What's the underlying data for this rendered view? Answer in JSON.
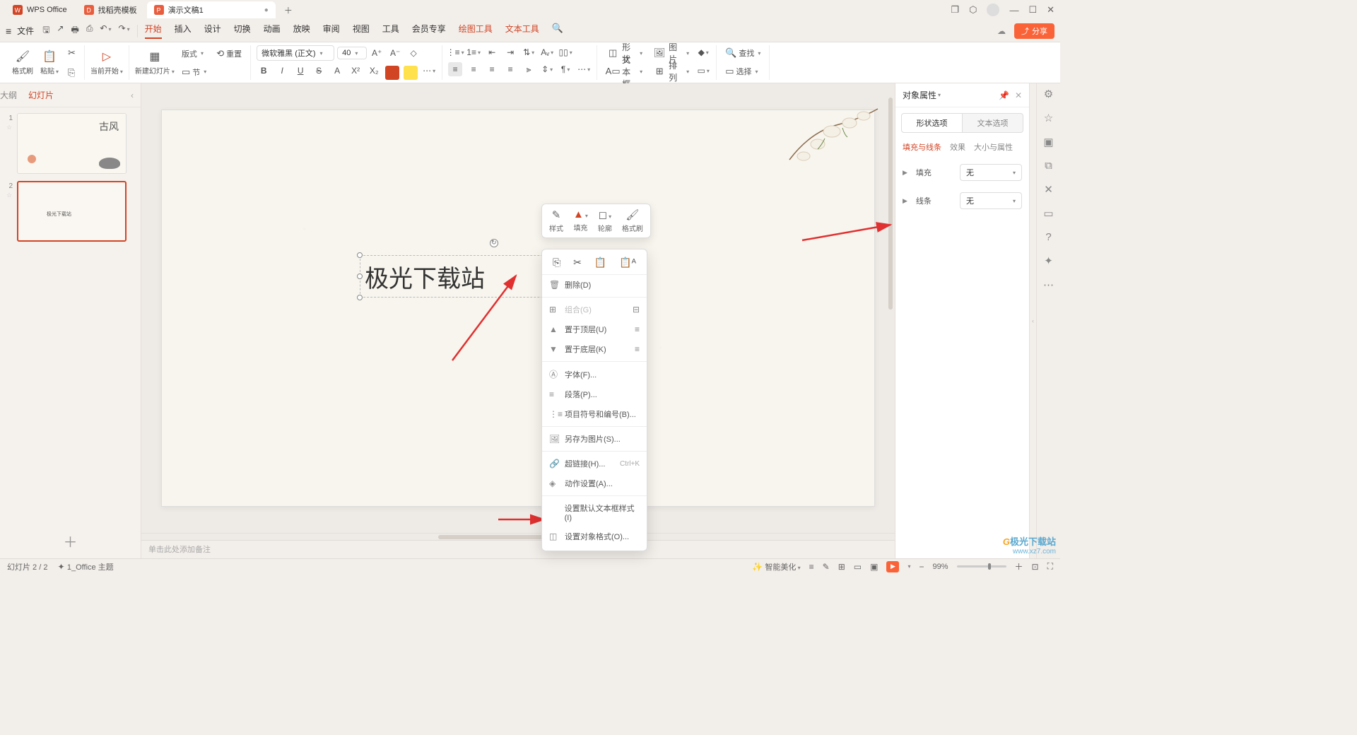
{
  "titlebar": {
    "tabs": [
      {
        "label": "WPS Office"
      },
      {
        "label": "找稻壳模板"
      },
      {
        "label": "演示文稿1"
      }
    ]
  },
  "filerow": {
    "file": "文件",
    "tabs": [
      "开始",
      "插入",
      "设计",
      "切换",
      "动画",
      "放映",
      "审阅",
      "视图",
      "工具",
      "会员专享",
      "绘图工具",
      "文本工具"
    ],
    "share": "分享"
  },
  "ribbon": {
    "format_painter": "格式刷",
    "paste": "粘贴",
    "from_current": "当前开始",
    "new_slide": "新建幻灯片",
    "layout": "版式",
    "section": "节",
    "reset": "重置",
    "font_name": "微软雅黑 (正文)",
    "font_size": "40",
    "shape": "形状",
    "image": "图片",
    "textbox": "文本框",
    "arrange": "排列",
    "find": "查找",
    "select": "选择"
  },
  "sidebar": {
    "tabs": {
      "outline": "大纲",
      "slides": "幻灯片"
    },
    "thumb2_text": "极光下载站"
  },
  "slide": {
    "textbox": "极光下载站"
  },
  "float": {
    "style": "样式",
    "fill": "填充",
    "outline": "轮廓",
    "format": "格式刷"
  },
  "ctx": {
    "delete": "删除(D)",
    "group": "组合(G)",
    "bring_front": "置于顶层(U)",
    "send_back": "置于底层(K)",
    "font": "字体(F)...",
    "paragraph": "段落(P)...",
    "bullets": "项目符号和编号(B)...",
    "save_as_pic": "另存为图片(S)...",
    "hyperlink": "超链接(H)...",
    "hyperlink_shortcut": "Ctrl+K",
    "action": "动作设置(A)...",
    "default_textbox": "设置默认文本框样式(I)",
    "format_object": "设置对象格式(O)..."
  },
  "rpanel": {
    "title": "对象属性",
    "tab_shape": "形状选项",
    "tab_text": "文本选项",
    "sub_fill": "填充与线条",
    "sub_effect": "效果",
    "sub_size": "大小与属性",
    "fill": "填充",
    "fill_val": "无",
    "line": "线条",
    "line_val": "无"
  },
  "notes": "单击此处添加备注",
  "status": {
    "slide": "幻灯片 2 / 2",
    "theme": "1_Office 主题",
    "beautify": "智能美化",
    "zoom": "99%"
  },
  "watermark": {
    "brand": "极光下载站",
    "url": "www.xz7.com"
  }
}
